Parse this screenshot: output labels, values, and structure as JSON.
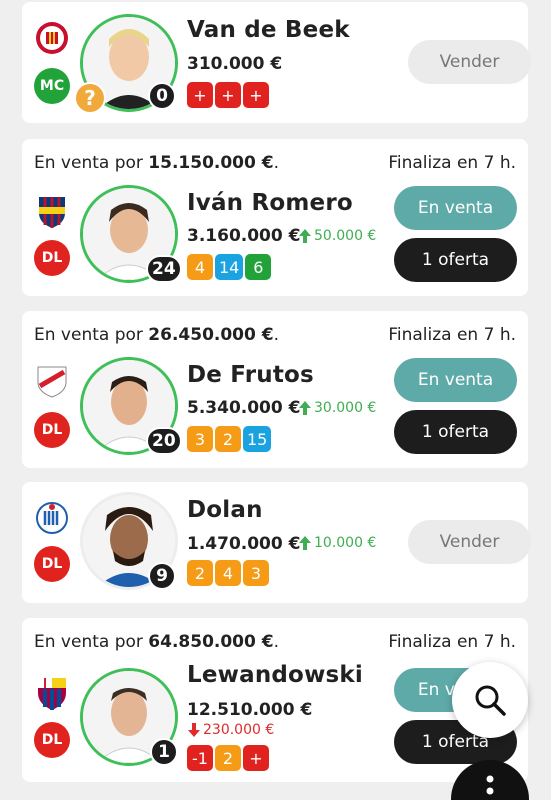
{
  "players": [
    {
      "name": "Van de Beek",
      "value": "310.000 €",
      "position": "MC",
      "number": "0",
      "club_icon": "girona-crest-icon",
      "points": [
        "+",
        "+",
        "+"
      ],
      "button": "Vender"
    },
    {
      "sale_prefix": "En venta por ",
      "sale_price": "15.150.000 €",
      "sale_suffix": ".",
      "ends": "Finaliza en 7 h.",
      "name": "Iván Romero",
      "value": "3.160.000 €",
      "delta": "50.000 €",
      "position": "DL",
      "number": "24",
      "club_icon": "levante-crest-icon",
      "points": [
        "4",
        "14",
        "6"
      ],
      "button_primary": "En venta",
      "button_secondary": "1 oferta"
    },
    {
      "sale_prefix": "En venta por ",
      "sale_price": "26.450.000 €",
      "sale_suffix": ".",
      "ends": "Finaliza en 7 h.",
      "name": "De Frutos",
      "value": "5.340.000 €",
      "delta": "30.000 €",
      "position": "DL",
      "number": "20",
      "club_icon": "rayo-vallecano-crest-icon",
      "points": [
        "3",
        "2",
        "15"
      ],
      "button_primary": "En venta",
      "button_secondary": "1 oferta"
    },
    {
      "name": "Dolan",
      "value": "1.470.000 €",
      "delta": "10.000 €",
      "position": "DL",
      "number": "9",
      "club_icon": "espanyol-crest-icon",
      "points": [
        "2",
        "4",
        "3"
      ],
      "button": "Vender"
    },
    {
      "sale_prefix": "En venta por ",
      "sale_price": "64.850.000 €",
      "sale_suffix": ".",
      "ends": "Finaliza en 7 h.",
      "name": "Lewandowski",
      "value": "12.510.000 €",
      "delta": "230.000 €",
      "position": "DL",
      "number": "1",
      "club_icon": "barcelona-crest-icon",
      "points": [
        "-1",
        "2",
        "+"
      ],
      "button_primary": "En venta",
      "button_secondary": "1 oferta"
    }
  ],
  "status": {
    "unknown_badge": "?"
  },
  "fab": {
    "search_icon": "search-icon",
    "more_icon": "more-vertical-icon"
  }
}
